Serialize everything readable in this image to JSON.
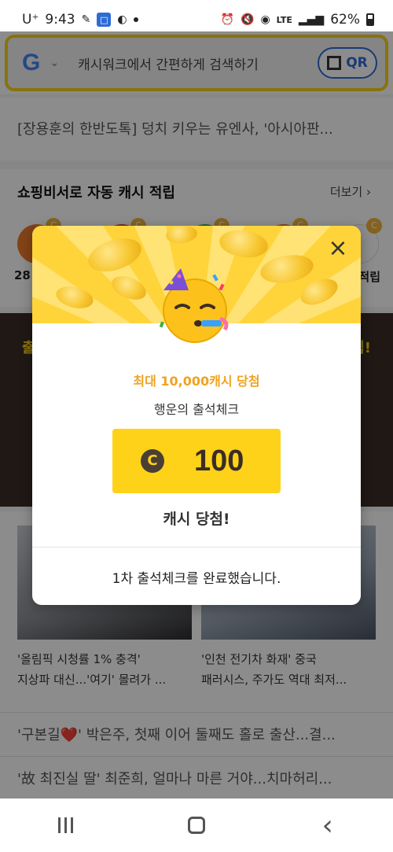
{
  "status_bar": {
    "carrier": "U⁺",
    "time": "9:43",
    "network": "LTE",
    "battery": "62%"
  },
  "search": {
    "google_logo": "G",
    "placeholder": "캐시워크에서 간편하게 검색하기",
    "qr_label": "QR"
  },
  "news_top": "[장용훈의 한반도톡] 덩치 키우는 유엔사, '아시아판...",
  "shopping": {
    "title": "쇼핑비서로 자동 캐시 적립",
    "more": "더보기 ›",
    "label_left": "28",
    "label_right": "적립",
    "coin_mark": "C"
  },
  "dark_band": {
    "left": "출",
    "right": "립!"
  },
  "cards": [
    {
      "text_line1": "'올림픽 시청률 1% 충격'",
      "text_line2": "지상파 대신...'여기' 몰려가 ..."
    },
    {
      "text_line1": "'인천 전기차 화재' 중국",
      "text_line2": "패러시스, 주가도 역대 최저..."
    }
  ],
  "news_list": [
    "'구본길❤️' 박은주, 첫째 이어 둘째도 홀로 출산...결...",
    "'故 최진실 딸' 최준희, 얼마나 마른 거야...치마허리..."
  ],
  "modal": {
    "close": "×",
    "win_title": "최대 10,000캐시 당첨",
    "win_sub": "행운의 출석체크",
    "coin_symbol": "C",
    "amount": "100",
    "win_label": "캐시 당첨!",
    "footer": "1차 출석체크를 완료했습니다."
  },
  "nav": {
    "back": "‹"
  },
  "colors": {
    "accent_yellow": "#ffd21a",
    "win_orange": "#f0a320",
    "dark_brown": "#3a2d26"
  }
}
